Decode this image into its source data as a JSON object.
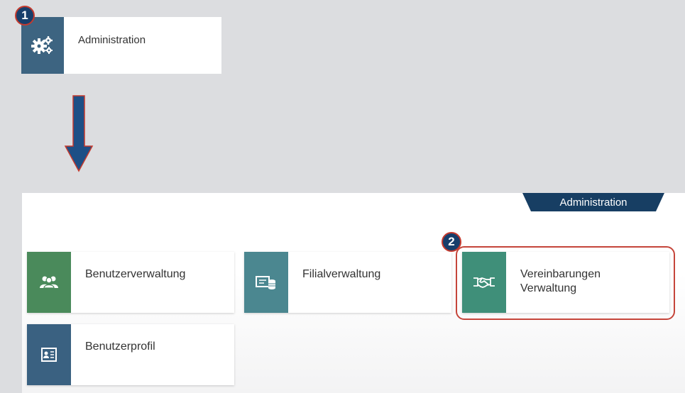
{
  "top_tile": {
    "label": "Administration",
    "icon": "gears-icon"
  },
  "badges": {
    "step1": "1",
    "step2": "2"
  },
  "panel": {
    "tab_title": "Administration"
  },
  "tiles": [
    {
      "label": "Benutzerverwaltung",
      "icon": "users-icon",
      "color": "#4a8a5b"
    },
    {
      "label": "Filialverwaltung",
      "icon": "branch-icon",
      "color": "#4b8790"
    },
    {
      "label": "Vereinbarungen Verwaltung",
      "icon": "handshake-icon",
      "color": "#3f8f79"
    },
    {
      "label": "Benutzerprofil",
      "icon": "profile-card-icon",
      "color": "#3a6181"
    }
  ],
  "colors": {
    "background": "#dcdde0",
    "badge_fill": "#173e6b",
    "badge_border": "#c43a2e",
    "arrow_fill": "#1d4f86",
    "arrow_outline": "#c43a2e",
    "tab_fill": "#173e63",
    "highlight": "#c5453a"
  }
}
